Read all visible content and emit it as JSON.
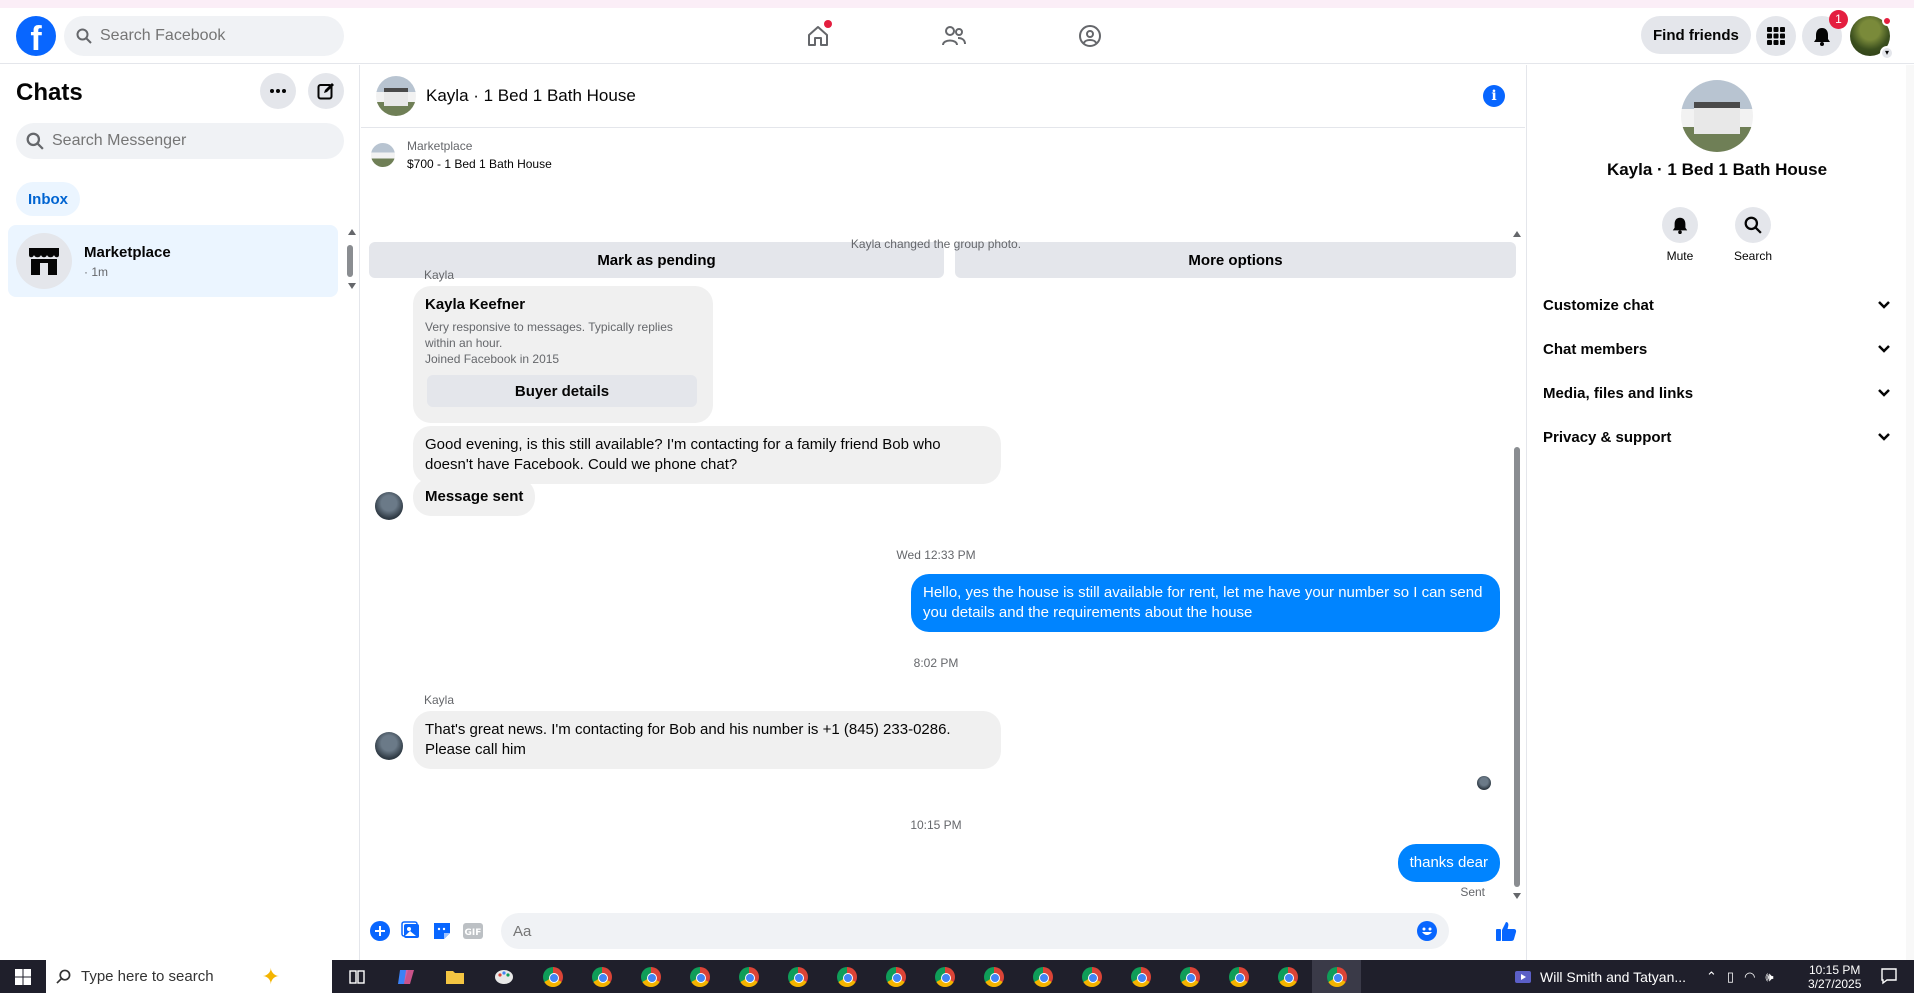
{
  "topnav": {
    "search_placeholder": "Search Facebook",
    "find_friends": "Find friends",
    "notifications_count": "1",
    "logo_letter": "f"
  },
  "sidebar": {
    "title": "Chats",
    "search_placeholder": "Search Messenger",
    "inbox_label": "Inbox",
    "chats": [
      {
        "name": "Marketplace",
        "sub": "· 1m"
      }
    ]
  },
  "chat": {
    "title": "Kayla · 1 Bed 1 Bath House",
    "marketplace_label": "Marketplace",
    "listing": "$700 - 1 Bed 1 Bath House",
    "mark_pending": "Mark as pending",
    "more_options": "More options",
    "system_msg": "Kayla changed the group photo.",
    "sender1": "Kayla",
    "profile_name": "Kayla Keefner",
    "profile_desc1": "Very responsive to messages. Typically replies within an hour.",
    "profile_desc2": "Joined Facebook in 2015",
    "buyer_details": "Buyer details",
    "msg1": "Good evening, is this still available? I'm contacting for a family friend Bob  who doesn't have Facebook. Could we phone chat?",
    "msg2": "Message sent",
    "time1": "Wed 12:33 PM",
    "msg3": "Hello, yes the house is still available for rent, let me have your number so I can send you details and the requirements about the house",
    "time2": "8:02 PM",
    "sender2": "Kayla",
    "msg4": "That's great news. I'm contacting for Bob and his number is +1 (845) 233-0286. Please call him",
    "time3": "10:15 PM",
    "msg5": "thanks dear",
    "sent": "Sent",
    "composer_placeholder": "Aa",
    "gif_label": "GIF"
  },
  "right_panel": {
    "name": "Kayla · 1 Bed 1 Bath House",
    "mute": "Mute",
    "search": "Search",
    "sections": [
      "Customize chat",
      "Chat members",
      "Media, files and links",
      "Privacy & support"
    ]
  },
  "taskbar": {
    "search_placeholder": "Type here to search",
    "media_title": "Will Smith and Tatyan...",
    "time": "10:15 PM",
    "date": "3/27/2025"
  },
  "colors": {
    "accent": "#0866ff",
    "bubble_out": "#0084ff",
    "bubble_in": "#f0f0f0",
    "badge": "#e41e3f"
  }
}
